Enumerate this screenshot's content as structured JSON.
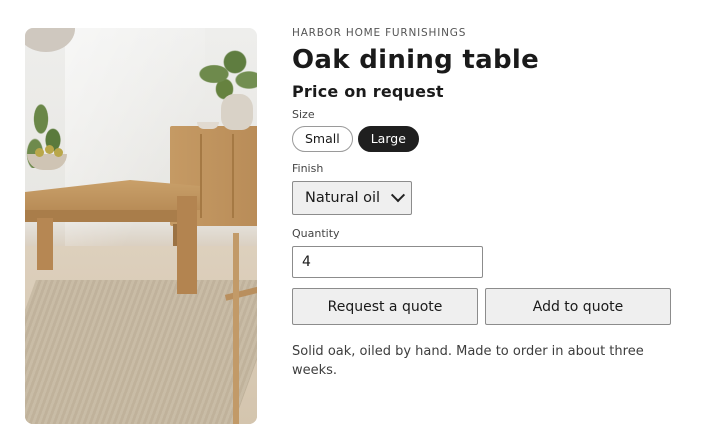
{
  "product": {
    "brand": "HARBOR HOME FURNISHINGS",
    "title": "Oak dining table",
    "price": "Price on request",
    "image_alt": "Oak dining table in a room with a rug, sideboard and plants",
    "description": "Solid oak, oiled by hand. Made to order in about three weeks."
  },
  "size": {
    "label": "Size",
    "options": [
      "Small",
      "Large"
    ],
    "selected": "Large"
  },
  "finish": {
    "label": "Finish",
    "selected": "Natural oil",
    "icon": "chevron-down-icon"
  },
  "quantity": {
    "label": "Quantity",
    "value": "4"
  },
  "actions": {
    "request_quote": "Request a quote",
    "add_to_quote": "Add to quote"
  },
  "colors": {
    "selected_pill": "#1f1f1f",
    "button_bg": "#efefef",
    "text": "#1a1a1a"
  }
}
